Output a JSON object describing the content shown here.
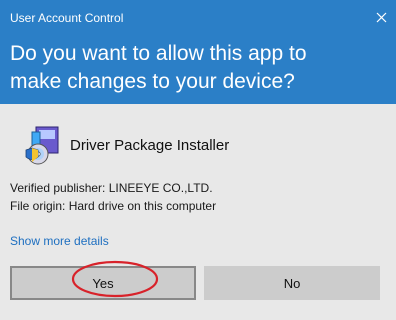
{
  "window": {
    "title": "User Account Control",
    "close_glyph": "✕"
  },
  "header": {
    "question": "Do you want to allow this app to make changes to your device?"
  },
  "app": {
    "name": "Driver Package Installer",
    "icon": "installer-cd-icon"
  },
  "info": {
    "publisher": "Verified publisher: LINEEYE CO.,LTD.",
    "origin": "File origin: Hard drive on this computer"
  },
  "details_link": "Show more details",
  "buttons": {
    "yes": "Yes",
    "no": "No"
  },
  "colors": {
    "header_bg": "#2b7fc7",
    "body_bg": "#e8e8e8",
    "button_bg": "#cccccc",
    "link": "#1e6fc0",
    "annotation": "#d8222a"
  }
}
